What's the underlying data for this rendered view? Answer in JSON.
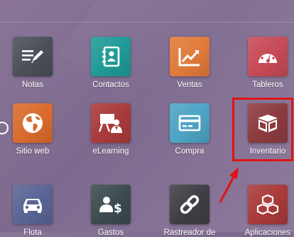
{
  "colors": {
    "background": "#83709a",
    "highlight": "#e01414"
  },
  "apps": [
    {
      "label": "Notas",
      "icon": "notes-icon",
      "color": "#4a4f58"
    },
    {
      "label": "Contactos",
      "icon": "contacts-icon",
      "color": "#1f9a96"
    },
    {
      "label": "Ventas",
      "icon": "sales-chart-icon",
      "color": "#e07a3a"
    },
    {
      "label": "Tableros",
      "icon": "dashboard-gauge-icon",
      "color": "#c64a55"
    },
    {
      "label": "Sitio web",
      "icon": "globe-icon",
      "color": "#d96b2c"
    },
    {
      "label": "eLearning",
      "icon": "elearning-icon",
      "color": "#a83a3a"
    },
    {
      "label": "Compra",
      "icon": "purchase-card-icon",
      "color": "#4da3c4"
    },
    {
      "label": "Inventario",
      "icon": "box-icon",
      "color": "#8c3b3f"
    },
    {
      "label": "Flota",
      "icon": "car-icon",
      "color": "#5a6494"
    },
    {
      "label": "Gastos",
      "icon": "expense-icon",
      "color": "#3c4b4f"
    },
    {
      "label": "Rastreador de",
      "icon": "link-icon",
      "color": "#3e3f44"
    },
    {
      "label": "Aplicaciones",
      "icon": "cubes-icon",
      "color": "#a83a3a"
    }
  ]
}
